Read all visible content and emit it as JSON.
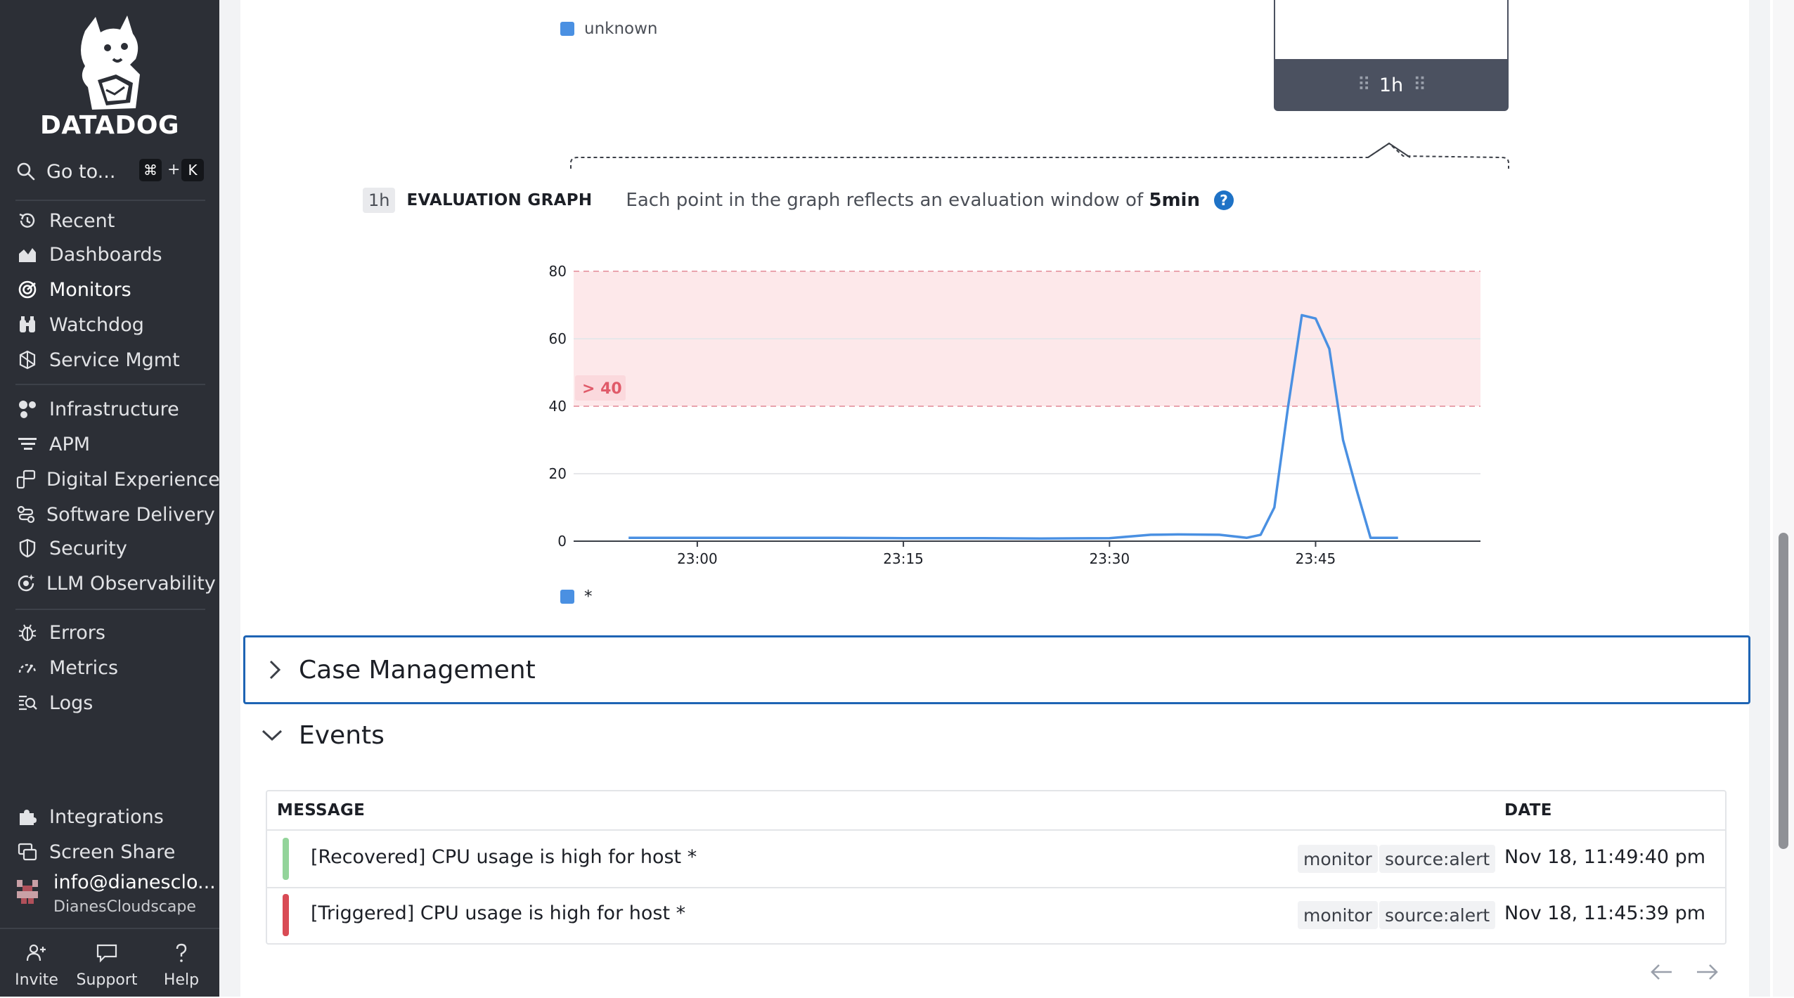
{
  "brand": {
    "name": "DATADOG"
  },
  "sidebar": {
    "goto": {
      "label": "Go to...",
      "shortcut_key1": "⌘",
      "shortcut_plus": "+",
      "shortcut_key2": "K"
    },
    "groups": [
      [
        {
          "label": "Recent",
          "icon": "history-icon"
        },
        {
          "label": "Dashboards",
          "icon": "dashboard-icon"
        },
        {
          "label": "Monitors",
          "icon": "monitor-icon",
          "active": true
        },
        {
          "label": "Watchdog",
          "icon": "binoculars-icon"
        },
        {
          "label": "Service Mgmt",
          "icon": "service-mgmt-icon"
        }
      ],
      [
        {
          "label": "Infrastructure",
          "icon": "infrastructure-icon"
        },
        {
          "label": "APM",
          "icon": "apm-icon"
        },
        {
          "label": "Digital Experience",
          "icon": "digital-experience-icon"
        },
        {
          "label": "Software Delivery",
          "icon": "software-delivery-icon"
        },
        {
          "label": "Security",
          "icon": "shield-icon"
        },
        {
          "label": "LLM Observability",
          "icon": "llm-icon"
        }
      ],
      [
        {
          "label": "Errors",
          "icon": "bug-icon"
        },
        {
          "label": "Metrics",
          "icon": "gauge-icon"
        },
        {
          "label": "Logs",
          "icon": "logs-icon"
        }
      ],
      [
        {
          "label": "Integrations",
          "icon": "puzzle-icon"
        },
        {
          "label": "Screen Share",
          "icon": "screen-share-icon"
        }
      ]
    ],
    "account": {
      "email": "info@dianesclo...",
      "org": "DianesCloudscape"
    },
    "bottom": [
      {
        "label": "Invite",
        "icon": "invite-icon"
      },
      {
        "label": "Support",
        "icon": "chat-icon"
      },
      {
        "label": "Help",
        "icon": "help-icon"
      }
    ]
  },
  "top_legend": {
    "label": "unknown",
    "color": "#4a90e2"
  },
  "window_selector": {
    "label": "1h"
  },
  "evaluation": {
    "window_pill": "1h",
    "title": "EVALUATION GRAPH",
    "desc_prefix": "Each point in the graph reflects an evaluation window of",
    "desc_value": "5min",
    "help_glyph": "?"
  },
  "chart_data": {
    "type": "line",
    "x": [
      "22:55",
      "23:00",
      "23:05",
      "23:10",
      "23:15",
      "23:20",
      "23:25",
      "23:30",
      "23:33",
      "23:35",
      "23:38",
      "23:40",
      "23:41",
      "23:42",
      "23:43",
      "23:44",
      "23:45",
      "23:46",
      "23:47",
      "23:48",
      "23:49",
      "23:50",
      "23:51"
    ],
    "series": [
      {
        "name": "*",
        "color": "#4a90e2",
        "values": [
          1,
          1,
          1,
          1,
          0.9,
          0.9,
          0.8,
          0.9,
          1.9,
          2,
          1.9,
          1,
          1.9,
          10,
          40,
          67,
          66,
          57,
          30,
          15,
          1,
          1,
          1
        ]
      }
    ],
    "xticks": [
      "23:00",
      "23:15",
      "23:30",
      "23:45"
    ],
    "yticks": [
      0,
      20,
      40,
      60,
      80
    ],
    "ylim": [
      0,
      80
    ],
    "threshold": {
      "label": "> 40",
      "value": 40,
      "color": "#e05a69"
    },
    "grid": true,
    "legend": "bottom-left"
  },
  "case_management": {
    "title": "Case Management"
  },
  "events": {
    "title": "Events",
    "columns": {
      "message": "MESSAGE",
      "date": "DATE"
    },
    "rows": [
      {
        "message": "[Recovered] CPU usage is high for host *",
        "status_color": "#93d49a",
        "tags": [
          "monitor",
          "source:alert"
        ],
        "date": "Nov 18, 11:49:40 pm"
      },
      {
        "message": "[Triggered] CPU usage is high for host *",
        "status_color": "#d94b55",
        "tags": [
          "monitor",
          "source:alert"
        ],
        "date": "Nov 18, 11:45:39 pm"
      }
    ],
    "pager": {
      "prev": "←",
      "next": "→"
    }
  }
}
